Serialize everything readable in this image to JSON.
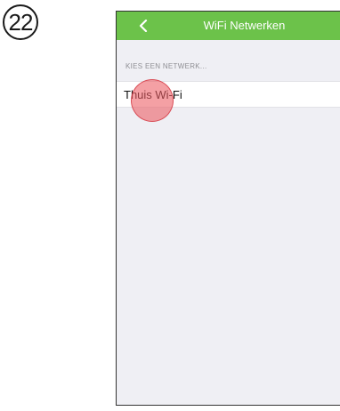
{
  "step": {
    "number": "22"
  },
  "nav": {
    "title": "WiFi Netwerken",
    "back_icon": "chevron-left-icon",
    "bar_color": "#6cc24a"
  },
  "networks": {
    "section_header": "KIES EEN NETWERK...",
    "items": [
      {
        "label": "Thuis Wi-Fi"
      }
    ]
  },
  "overlay": {
    "tap_indicator_color": "#ec5c62"
  }
}
